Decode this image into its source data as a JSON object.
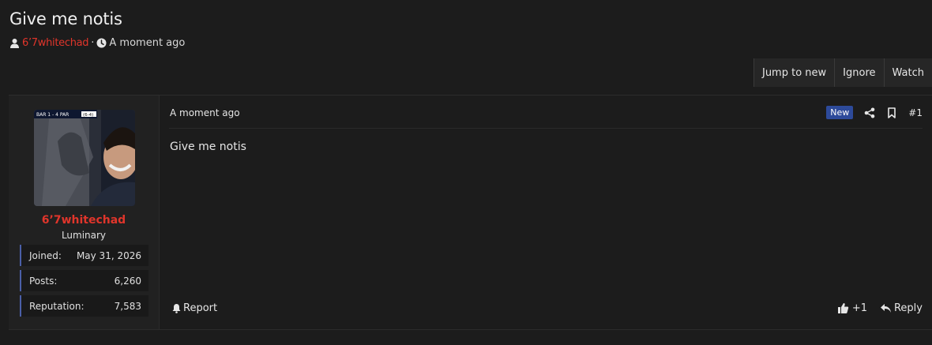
{
  "thread": {
    "title": "Give me notis",
    "author": "6’7whitechad",
    "separator": "·",
    "time": "A moment ago"
  },
  "actions": {
    "jump_to_new": "Jump to new",
    "ignore": "Ignore",
    "watch": "Watch"
  },
  "user": {
    "name": "6’7whitechad",
    "title": "Luminary",
    "stats": [
      {
        "label": "Joined:",
        "value": "May 31, 2026"
      },
      {
        "label": "Posts:",
        "value": "6,260"
      },
      {
        "label": "Reputation:",
        "value": "7,583"
      }
    ],
    "avatar_scoreboard": "BAR 1 - 4 PAR (6-4)"
  },
  "post": {
    "time": "A moment ago",
    "badge": "New",
    "number": "#1",
    "body": "Give me notis",
    "report_label": "Report",
    "like_count": "+1",
    "reply_label": "Reply"
  },
  "icons": {
    "user": "user-icon",
    "clock": "clock-icon",
    "share": "share-icon",
    "bookmark": "bookmark-icon",
    "bell": "bell-icon",
    "thumbs_up": "thumbs-up-icon",
    "reply": "reply-icon"
  },
  "colors": {
    "background": "#1c1c1c",
    "accent_red": "#e0352b",
    "badge_blue": "#2d4a9a",
    "stat_border": "#4b5fa8"
  }
}
